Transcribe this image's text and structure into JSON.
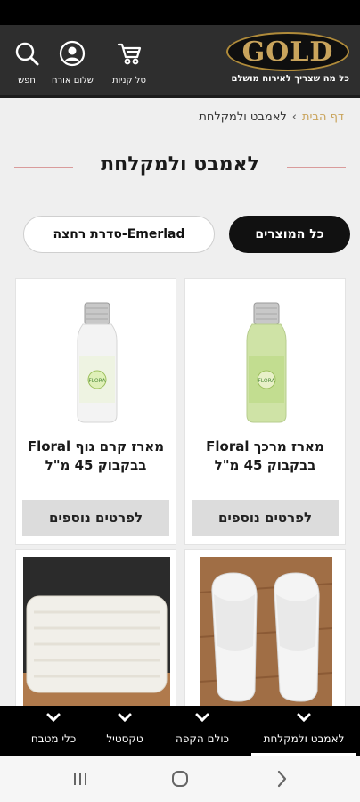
{
  "header": {
    "logo_text": "GOLD",
    "tagline": "כל מה שצריך לאירוח מושלם",
    "cart_label": "סל קניות",
    "account_label": "שלום אורח",
    "search_label": "חפש"
  },
  "breadcrumb": {
    "home": "דף הבית",
    "separator": "›",
    "current": "לאמבט ולמקלחת"
  },
  "page_title": "לאמבט ולמקלחת",
  "filters": {
    "all": "כל המוצרים",
    "series": "Emerlad-סדרת רחצה"
  },
  "products": [
    {
      "name_line1": "מארז מרכך Floral",
      "name_line2": "בבקבוק 45 מ\"ל",
      "button": "לפרטים נוספים",
      "bottle_color": "#cfe3a6",
      "label_text": "FLORA"
    },
    {
      "name_line1": "מארז קרם גוף Floral",
      "name_line2": "בבקבוק 45 מ\"ל",
      "button": "לפרטים נוספים",
      "bottle_color": "#f3f3f3",
      "label_text": "FLORA"
    }
  ],
  "categories": [
    {
      "label": "לאמבט ולמקלחת",
      "active": true
    },
    {
      "label": "כולם הקפה",
      "active": false
    },
    {
      "label": "טקסטיל",
      "active": false
    },
    {
      "label": "כלי מטבח",
      "active": false
    }
  ],
  "colors": {
    "gold": "#c9a45c",
    "header_bg": "#2e2e2e",
    "accent_line": "#d99b9b"
  },
  "icons": {
    "cart": "cart-icon",
    "account": "user-icon",
    "search": "search-icon",
    "chevron": "chevron-down-icon"
  }
}
